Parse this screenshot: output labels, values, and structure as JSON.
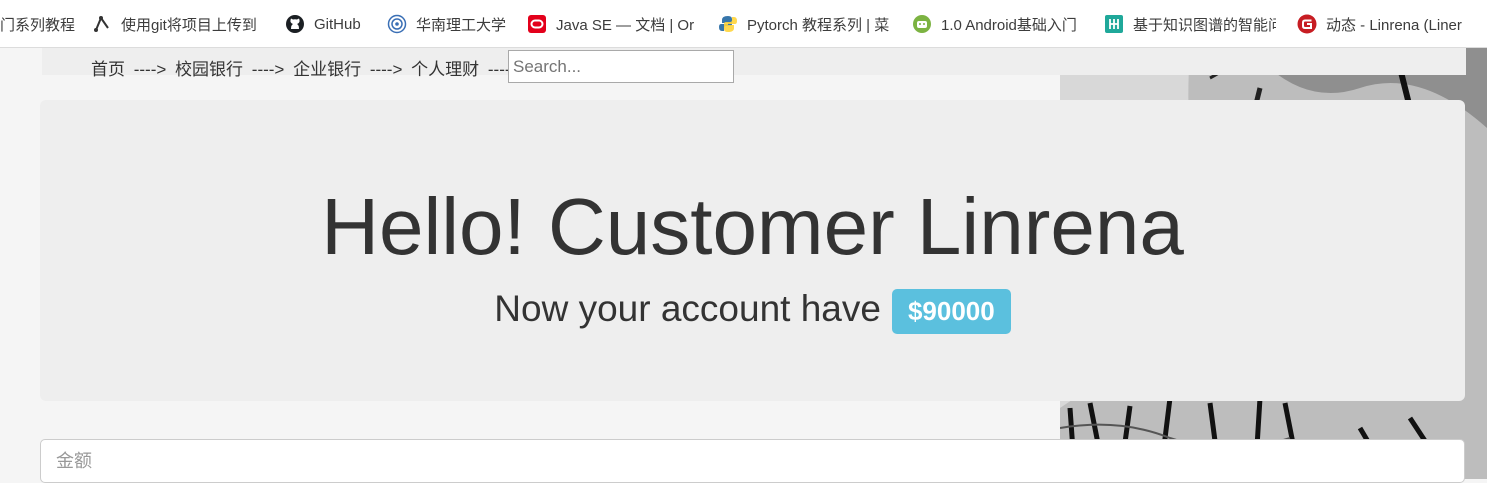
{
  "bookmarks": [
    {
      "label": "门系列教程",
      "icon": "document-icon"
    },
    {
      "label": "使用git将项目上传到",
      "icon": "git-tree-icon"
    },
    {
      "label": "GitHub",
      "icon": "github-icon"
    },
    {
      "label": "华南理工大学",
      "icon": "university-seal-icon"
    },
    {
      "label": "Java SE — 文档 | Or",
      "icon": "oracle-icon"
    },
    {
      "label": "Pytorch 教程系列 | 菜",
      "icon": "python-icon"
    },
    {
      "label": "1.0 Android基础入门",
      "icon": "android-icon"
    },
    {
      "label": "基于知识图谱的智能问",
      "icon": "dao-icon"
    },
    {
      "label": "动态 - Linrena (Liner",
      "icon": "gitee-icon"
    }
  ],
  "nav": {
    "crumbs": [
      "首页",
      "校园银行",
      "企业银行",
      "个人理财"
    ],
    "separator": "---->"
  },
  "search": {
    "placeholder": "Search...",
    "value": ""
  },
  "hero": {
    "title": "Hello! Customer Linrena",
    "subtitle": "Now your account have",
    "balance": "$90000"
  },
  "amount": {
    "placeholder": "金额",
    "value": ""
  },
  "colors": {
    "badge": "#5bc0de",
    "jumbotron": "#eeeeee"
  }
}
